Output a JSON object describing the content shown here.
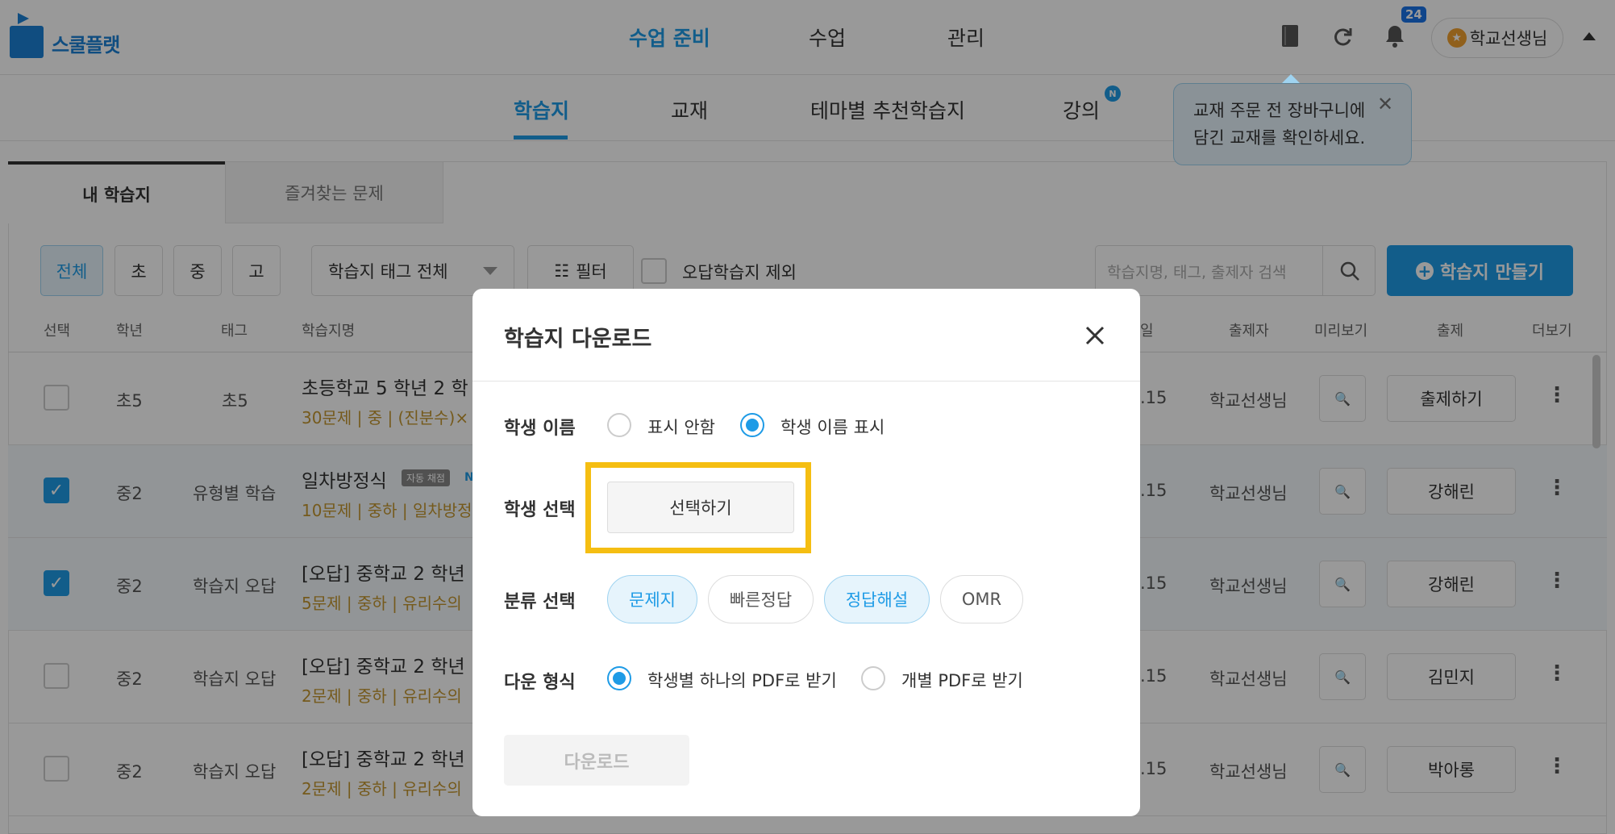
{
  "header": {
    "logo_text": "스쿨플랫",
    "nav": [
      "수업 준비",
      "수업",
      "관리"
    ],
    "notification_count": "24",
    "user_name": "학교선생님"
  },
  "subnav": {
    "tabs": [
      "학습지",
      "교재",
      "테마별 추천학습지",
      "강의"
    ],
    "new_badge": "N"
  },
  "tooltip": {
    "line1": "교재 주문 전 장바구니에",
    "line2": "담긴 교재를 확인하세요."
  },
  "content_tabs": [
    "내 학습지",
    "즐겨찾는 문제"
  ],
  "filters": {
    "grades": [
      "전체",
      "초",
      "중",
      "고"
    ],
    "tag_select": "학습지 태그 전체",
    "filter_label": "필터",
    "wrong_exclude": "오답학습지 제외",
    "search_placeholder": "학습지명, 태그, 출제자 검색",
    "create_button": "학습지 만들기"
  },
  "columns": {
    "select": "선택",
    "grade": "학년",
    "tag": "태그",
    "name": "학습지명",
    "date": "일",
    "author": "출제자",
    "preview": "미리보기",
    "assign": "출제",
    "more": "더보기"
  },
  "rows": [
    {
      "checked": false,
      "grade": "초5",
      "tag": "초5",
      "title": "초등학교 5 학년 2 학",
      "badge": "",
      "badge2": "",
      "meta": "30문제 | 중 | (진분수)×",
      "date": ".15",
      "author": "학교선생님",
      "assign": "출제하기"
    },
    {
      "checked": true,
      "grade": "중2",
      "tag": "유형별 학습",
      "title": "일차방정식",
      "badge": "자동 채점",
      "badge2": "N",
      "meta": "10문제 | 중하 | 일차방정",
      "date": ".15",
      "author": "학교선생님",
      "assign": "강해린"
    },
    {
      "checked": true,
      "grade": "중2",
      "tag": "학습지 오답",
      "title": "[오답] 중학교 2 학년",
      "badge": "",
      "badge2": "",
      "meta": "5문제 | 중하 | 유리수의",
      "date": ".15",
      "author": "학교선생님",
      "assign": "강해린"
    },
    {
      "checked": false,
      "grade": "중2",
      "tag": "학습지 오답",
      "title": "[오답] 중학교 2 학년",
      "badge": "",
      "badge2": "",
      "meta": "2문제 | 중하 | 유리수의",
      "date": ".15",
      "author": "학교선생님",
      "assign": "김민지"
    },
    {
      "checked": false,
      "grade": "중2",
      "tag": "학습지 오답",
      "title": "[오답] 중학교 2 학년",
      "badge": "",
      "badge2": "",
      "meta": "2문제 | 중하 | 유리수의",
      "date": ".15",
      "author": "학교선생님",
      "assign": "박아롱"
    }
  ],
  "modal": {
    "title": "학습지 다운로드",
    "student_name_label": "학생 이름",
    "name_options": [
      "표시 안함",
      "학생 이름 표시"
    ],
    "name_selected": "학생 이름 표시",
    "student_select_label": "학생 선택",
    "student_select_button": "선택하기",
    "category_label": "분류 선택",
    "categories": [
      "문제지",
      "빠른정답",
      "정답해설",
      "OMR"
    ],
    "categories_selected": [
      "문제지",
      "정답해설"
    ],
    "format_label": "다운 형식",
    "format_options": [
      "학생별 하나의 PDF로 받기",
      "개별 PDF로 받기"
    ],
    "format_selected": "학생별 하나의 PDF로 받기",
    "download_button": "다운로드"
  },
  "colors": {
    "accent": "#1e9be6",
    "highlight": "#f5be12"
  }
}
